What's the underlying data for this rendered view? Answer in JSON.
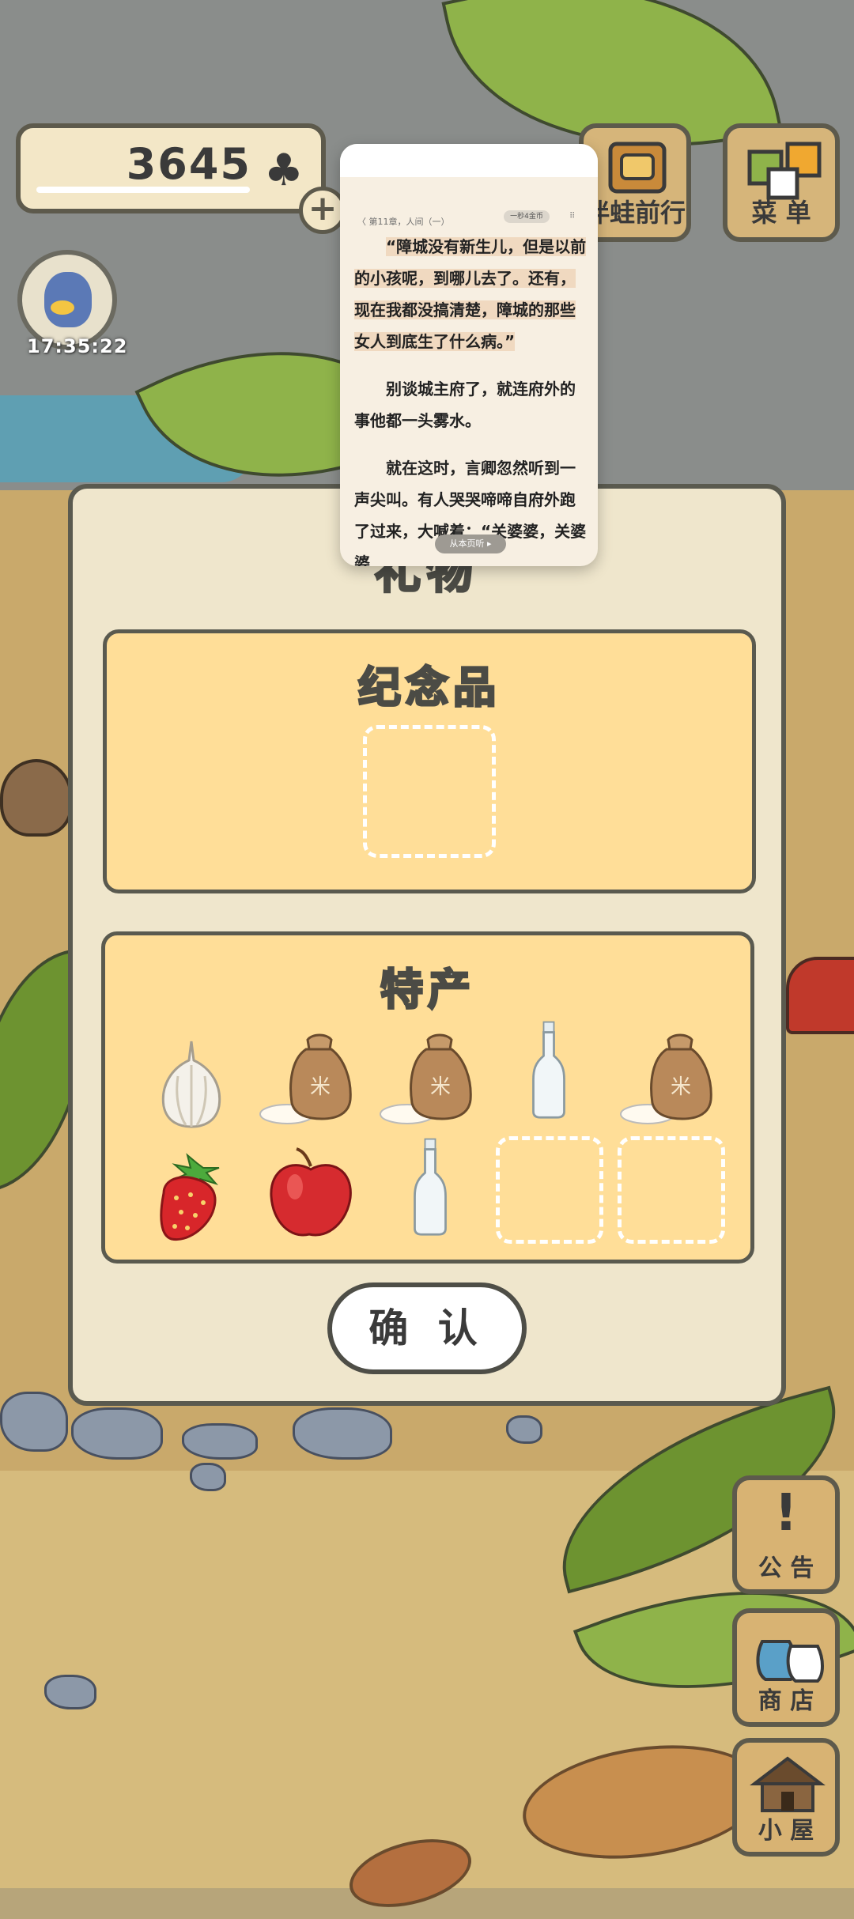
{
  "hud": {
    "currency_value": "3645",
    "currency_icon": "clover-icon",
    "add_label": "+",
    "timer": "17:35:22"
  },
  "top_buttons": {
    "travel_label": "伴蛙前行",
    "menu_label": "菜 单"
  },
  "dialog": {
    "title": "礼物",
    "souvenir_title": "纪念品",
    "specialty_title": "特产",
    "specialty_items": [
      "garlic",
      "rice-bag",
      "rice-bag",
      "bottle",
      "rice-bag",
      "strawberry",
      "apple",
      "bottle",
      "empty",
      "empty"
    ],
    "confirm_label": "确 认"
  },
  "side_buttons": {
    "notice_label": "公 告",
    "shop_label": "商 店",
    "house_label": "小 屋"
  },
  "reader": {
    "breadcrumb": "〈 第11章，人间（一）",
    "pill": "一秒4金币",
    "menu": "⠿",
    "paragraphs": [
      "“障城没有新生儿，但是以前的小孩呢，到哪儿去了。还有，现在我都没搞清楚，障城的那些女人到底生了什么病。”",
      "别谈城主府了，就连府外的事他都一头雾水。",
      "就在这时，言卿忽然听到一声尖叫。有人哭哭啼啼自府外跑了过来，大喊着：“关婆婆，关婆婆"
    ],
    "listen_label": "从本页听 ▸"
  },
  "colors": {
    "section_fill": "#ffde98",
    "dialog_fill": "#efe6cc",
    "outline": "#5a5a4f"
  }
}
